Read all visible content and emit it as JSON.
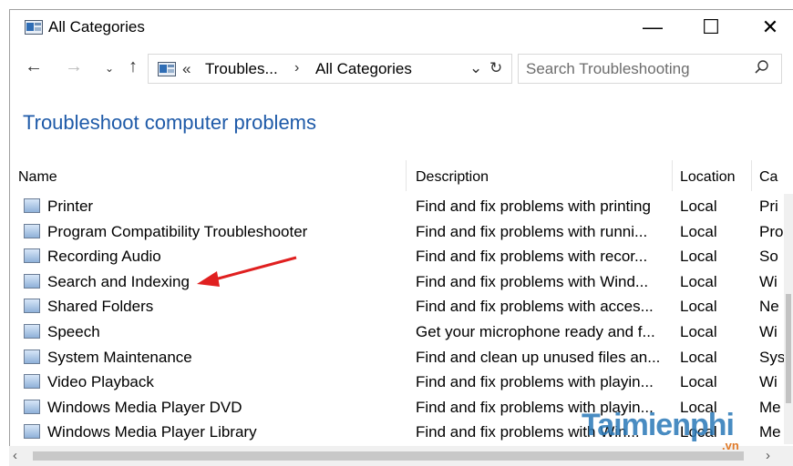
{
  "window": {
    "title": "All Categories",
    "minimize": "—",
    "maximize": "☐",
    "close": "✕"
  },
  "nav": {
    "back": "←",
    "forward": "→",
    "recent": "⌄",
    "up": "↑",
    "address_sep1": "«",
    "crumb1": "Troubles...",
    "address_sep2": "›",
    "crumb2": "All Categories",
    "dropdown": "⌄",
    "refresh": "↻"
  },
  "search": {
    "placeholder": "Search Troubleshooting",
    "value": ""
  },
  "page_title": "Troubleshoot computer problems",
  "columns": {
    "name": "Name",
    "description": "Description",
    "location": "Location",
    "category": "Ca"
  },
  "rows": [
    {
      "name": "Printer",
      "description": "Find and fix problems with printing",
      "location": "Local",
      "category": "Pri"
    },
    {
      "name": "Program Compatibility Troubleshooter",
      "description": "Find and fix problems with runni...",
      "location": "Local",
      "category": "Pro"
    },
    {
      "name": "Recording Audio",
      "description": "Find and fix problems with recor...",
      "location": "Local",
      "category": "So"
    },
    {
      "name": "Search and Indexing",
      "description": "Find and fix problems with Wind...",
      "location": "Local",
      "category": "Wi"
    },
    {
      "name": "Shared Folders",
      "description": "Find and fix problems with acces...",
      "location": "Local",
      "category": "Ne"
    },
    {
      "name": "Speech",
      "description": "Get your microphone ready and f...",
      "location": "Local",
      "category": "Wi"
    },
    {
      "name": "System Maintenance",
      "description": "Find and clean up unused files an...",
      "location": "Local",
      "category": "Sys"
    },
    {
      "name": "Video Playback",
      "description": "Find and fix problems with playin...",
      "location": "Local",
      "category": "Wi"
    },
    {
      "name": "Windows Media Player DVD",
      "description": "Find and fix problems with playin...",
      "location": "Local",
      "category": "Me"
    },
    {
      "name": "Windows Media Player Library",
      "description": "Find and fix problems with Win...",
      "location": "Local",
      "category": "Me"
    }
  ],
  "scroll": {
    "left": "‹",
    "right": "›"
  },
  "watermark": {
    "main": "Taimienphi",
    "sub": ".vn"
  },
  "colors": {
    "title_blue": "#1e5aa8",
    "annotation_red": "#e02020"
  }
}
